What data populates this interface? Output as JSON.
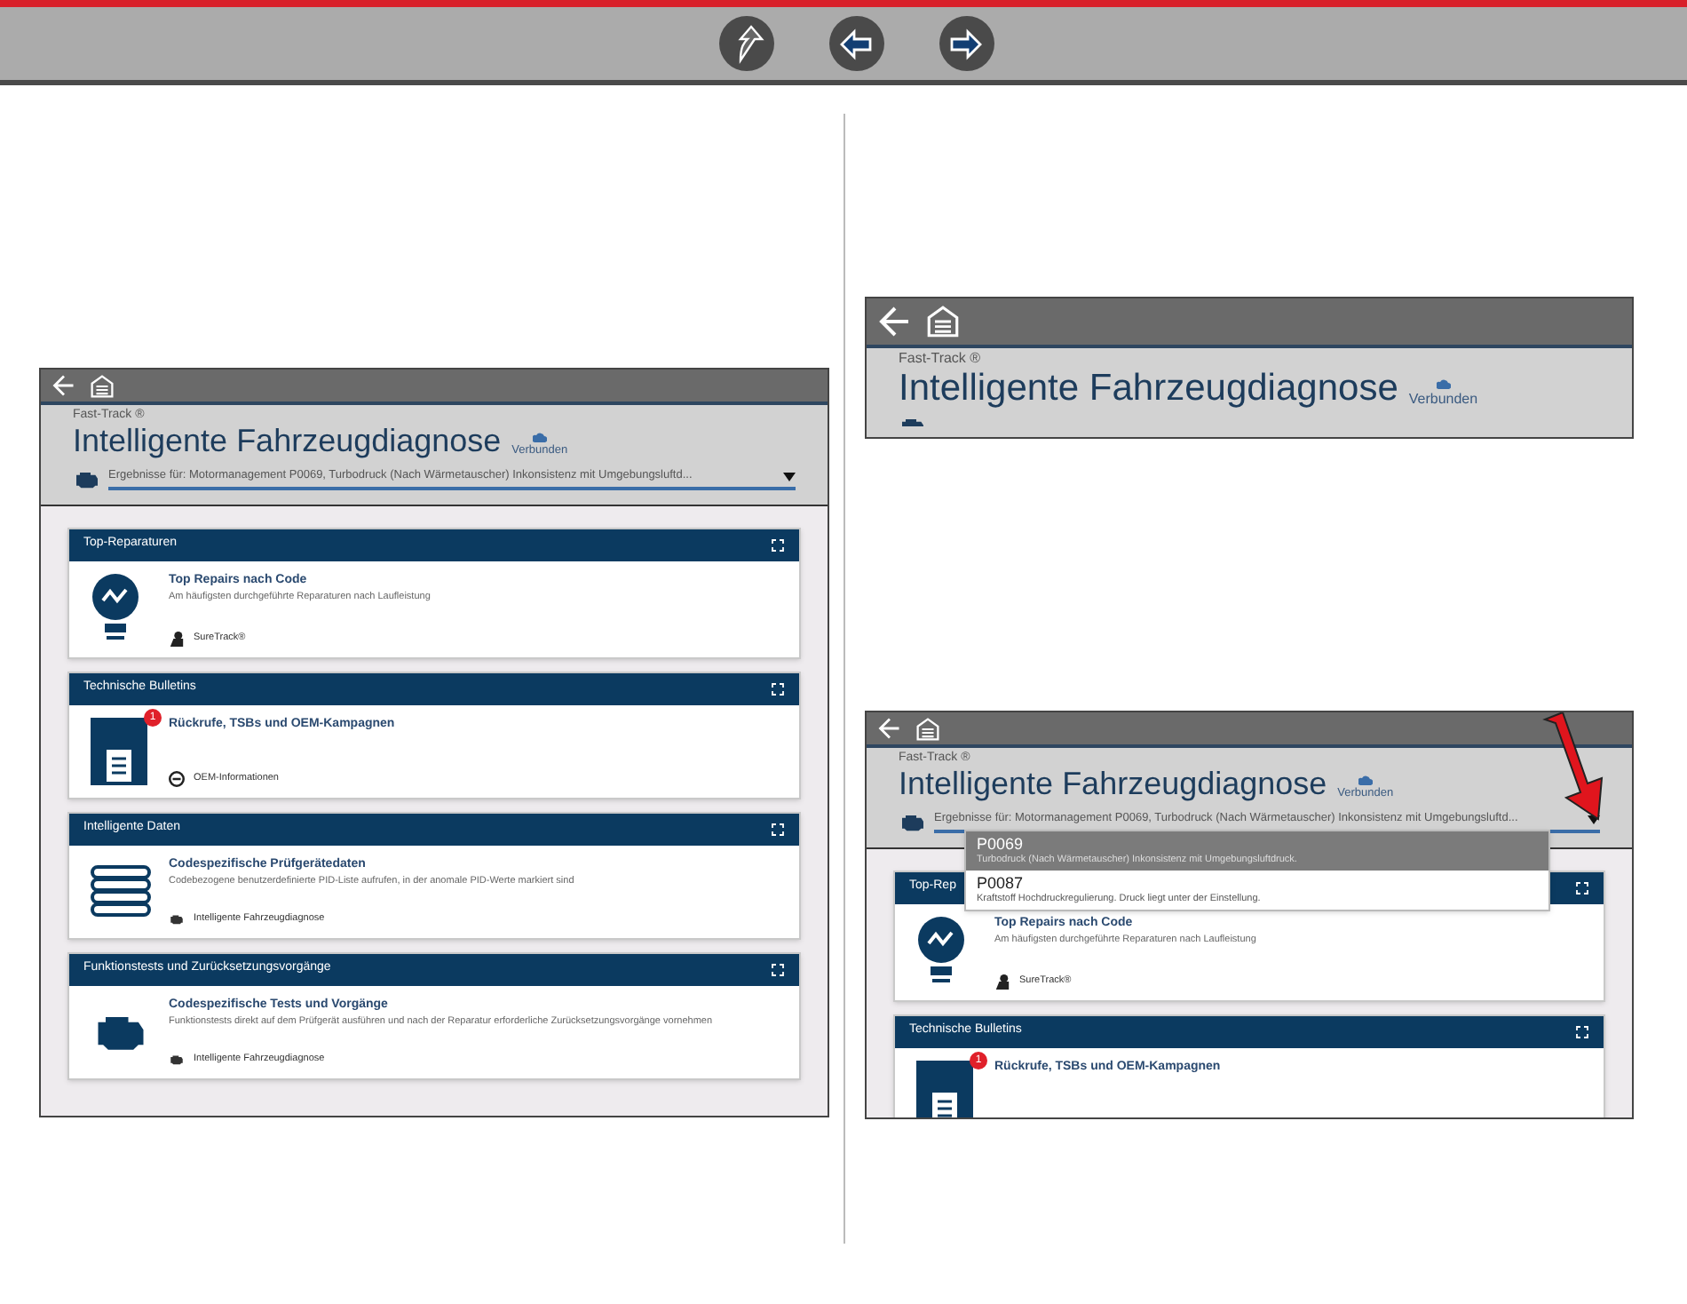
{
  "toolbar": {
    "buttons": [
      {
        "kind": "up"
      },
      {
        "kind": "back"
      },
      {
        "kind": "forward"
      }
    ]
  },
  "screenshots": [
    {
      "kind": "full",
      "app": {
        "subtitle": "Fast-Track ®",
        "title": "Intelligente Fahrzeugdiagnose",
        "status": "Verbunden"
      },
      "search": {
        "value": "Ergebnisse für: Motormanagement P0069, Turbodruck (Nach Wärmetauscher) Inkonsistenz mit Umgebungsluftd..."
      },
      "cards": [
        {
          "kind": "bulb",
          "title": "Top-Reparaturen",
          "heading": "Top Repairs nach Code",
          "description": "Am häufigsten durchgeführte Reparaturen nach Laufleistung",
          "link": {
            "kind": "person",
            "label": "SureTrack®"
          }
        },
        {
          "kind": "tsb",
          "title": "Technische Bulletins",
          "badge": "1",
          "heading": "Rückrufe, TSBs und OEM-Kampagnen",
          "link": {
            "kind": "circle",
            "label": "OEM-Informationen"
          }
        },
        {
          "kind": "list",
          "title": "Intelligente Daten",
          "heading": "Codespezifische Prüfgerätedaten",
          "description": "Codebezogene benutzerdefinierte PID-Liste aufrufen, in der anomale PID-Werte markiert sind",
          "link": {
            "kind": "engine",
            "label": "Intelligente Fahrzeugdiagnose"
          }
        },
        {
          "kind": "engine",
          "title": "Funktionstests und Zurücksetzungsvorgänge",
          "heading": "Codespezifische Tests und Vorgänge",
          "description": "Funktionstests direkt auf dem Prüfgerät ausführen und nach der Reparatur erforderliche Zurücksetzungsvorgänge vornehmen",
          "link": {
            "kind": "engine",
            "label": "Intelligente Fahrzeugdiagnose"
          }
        }
      ]
    },
    {
      "kind": "header",
      "app": {
        "subtitle": "Fast-Track ®",
        "title": "Intelligente Fahrzeugdiagnose",
        "status": "Verbunden"
      }
    },
    {
      "kind": "dropdown",
      "app": {
        "subtitle": "Fast-Track ®",
        "title": "Intelligente Fahrzeugdiagnose",
        "status": "Verbunden"
      },
      "search": {
        "value": "Ergebnisse für: Motormanagement P0069, Turbodruck (Nach Wärmetauscher) Inkonsistenz mit Umgebungsluftd..."
      },
      "dropdown": {
        "options": [
          {
            "code": "P0069",
            "description": "Turbodruck (Nach Wärmetauscher) Inkonsistenz mit Umgebungsluftdruck.",
            "selected": true
          },
          {
            "code": "P0087",
            "description": "Kraftstoff Hochdruckregulierung. Druck liegt unter der Einstellung.",
            "selected": false
          }
        ]
      },
      "cards": [
        {
          "kind": "bulb",
          "title": "Top-Rep",
          "heading": "Top Repairs nach Code",
          "description": "Am häufigsten durchgeführte Reparaturen nach Laufleistung",
          "link": {
            "kind": "person",
            "label": "SureTrack®"
          }
        },
        {
          "kind": "tsb",
          "title": "Technische Bulletins",
          "badge": "1",
          "heading": "Rückrufe, TSBs und OEM-Kampagnen"
        }
      ]
    }
  ]
}
